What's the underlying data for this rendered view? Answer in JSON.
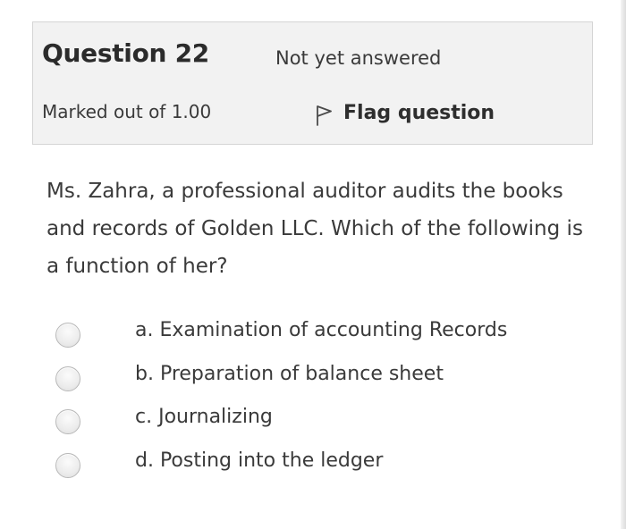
{
  "question": {
    "title": "Question 22",
    "state": "Not yet answered",
    "grade": "Marked out of 1.00",
    "flag_label": "Flag question",
    "flag_icon": "flag-icon",
    "text": "Ms. Zahra, a professional auditor audits the books and records of Golden LLC. Which of the following is a function of her?"
  },
  "answers": [
    {
      "label": "a. Examination of accounting Records",
      "selected": false
    },
    {
      "label": "b. Preparation of balance sheet",
      "selected": false
    },
    {
      "label": "c. Journalizing",
      "selected": false
    },
    {
      "label": "d. Posting into the ledger",
      "selected": false
    }
  ]
}
